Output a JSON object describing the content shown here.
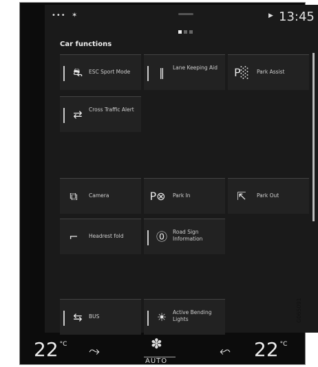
{
  "status": {
    "signal": "•••  ✶",
    "play_icon": "▶",
    "time": "13:45"
  },
  "pager": {
    "pages": 3,
    "active": 0
  },
  "section_title": "Car functions",
  "tiles": [
    {
      "label": "ESC Sport Mode",
      "icon": "esc-off-icon",
      "glyph": "⛐"
    },
    {
      "label": "Lane Keeping Aid",
      "icon": "lane-keeping-icon",
      "glyph": "‖"
    },
    {
      "label": "Park Assist",
      "icon": "park-assist-icon",
      "glyph": "P░"
    },
    {
      "label": "Cross Traffic Alert",
      "icon": "cross-traffic-icon",
      "glyph": "⇄"
    },
    {
      "label": "Camera",
      "icon": "camera-icon",
      "glyph": "⧉"
    },
    {
      "label": "Park In",
      "icon": "park-in-icon",
      "glyph": "P⊗"
    },
    {
      "label": "Park Out",
      "icon": "park-out-icon",
      "glyph": "⇱"
    },
    {
      "label": "Headrest fold",
      "icon": "headrest-icon",
      "glyph": "⌐"
    },
    {
      "label": "Road Sign Information",
      "icon": "road-sign-icon",
      "glyph": "⓪"
    },
    {
      "label": "BUS",
      "icon": "bus-icon",
      "glyph": "⇆"
    },
    {
      "label": "Active Bending Lights",
      "icon": "bending-lights-icon",
      "glyph": "☀"
    }
  ],
  "climate": {
    "left_temp": "22",
    "right_temp": "22",
    "unit": "°C",
    "mode": "AUTO",
    "seat_glyph": "⤳",
    "fan_glyph": "✽"
  },
  "image_code": "G065091"
}
